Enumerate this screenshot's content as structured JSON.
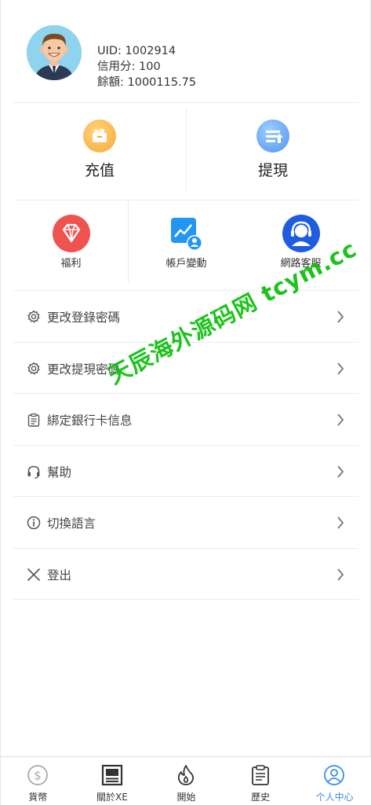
{
  "profile": {
    "uid": "UID: 1002914",
    "credit": "信用分: 100",
    "balance": "餘額: 1000115.75"
  },
  "actions": {
    "recharge": {
      "label": "充值",
      "icon": "wallet-icon"
    },
    "withdraw": {
      "label": "提現",
      "icon": "withdraw-icon"
    }
  },
  "shortcuts": [
    {
      "label": "福利",
      "icon": "diamond-icon"
    },
    {
      "label": "帳戶變動",
      "icon": "chart-user-icon"
    },
    {
      "label": "網路客服",
      "icon": "headset-icon"
    }
  ],
  "menu": [
    {
      "label": "更改登錄密碼",
      "icon": "gear-icon"
    },
    {
      "label": "更改提現密碼",
      "icon": "gear-icon"
    },
    {
      "label": "綁定銀行卡信息",
      "icon": "clipboard-icon"
    },
    {
      "label": "幫助",
      "icon": "headphones-icon"
    },
    {
      "label": "切換語言",
      "icon": "info-icon"
    },
    {
      "label": "登出",
      "icon": "close-icon"
    }
  ],
  "watermark": "天辰海外源码网 tcym.cc",
  "tabs": [
    {
      "label": "貨幣",
      "icon": "dollar-icon",
      "active": false
    },
    {
      "label": "關於XE",
      "icon": "newspaper-icon",
      "active": false
    },
    {
      "label": "開始",
      "icon": "flame-icon",
      "active": false
    },
    {
      "label": "歷史",
      "icon": "clipboard-icon",
      "active": false
    },
    {
      "label": "个人中心",
      "icon": "user-icon",
      "active": true
    }
  ],
  "colors": {
    "accent": "#3b8de6",
    "watermark": "#10c010",
    "recharge": "#f7a93b",
    "withdraw": "#5aa3f0",
    "welfare": "#ef5350",
    "account": "#2196f3",
    "service": "#1e5de0"
  }
}
